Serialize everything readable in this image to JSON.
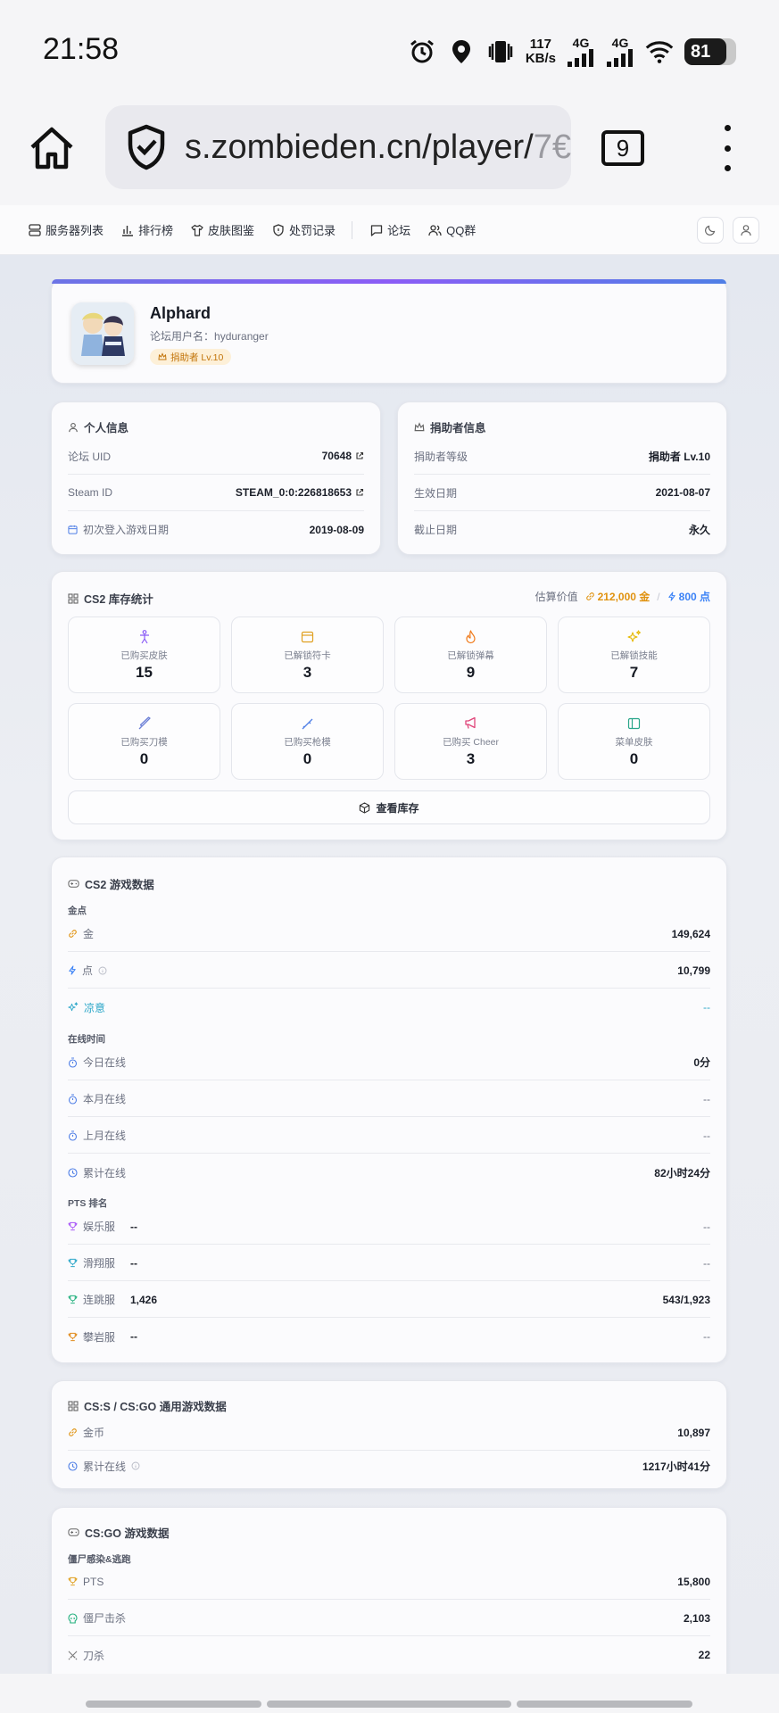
{
  "status": {
    "time": "21:58",
    "speed_value": "117",
    "speed_unit": "KB/s",
    "net1": "4G",
    "net2": "4G",
    "battery": "81"
  },
  "browser": {
    "url_main": "s.zombieden.cn/player/",
    "url_fade": "7€",
    "tab_count": "9"
  },
  "nav": {
    "items": [
      "服务器列表",
      "排行榜",
      "皮肤图鉴",
      "处罚记录",
      "论坛",
      "QQ群"
    ]
  },
  "profile": {
    "name": "Alphard",
    "forum_user_label": "论坛用户名：",
    "forum_user": "hyduranger",
    "badge": "捐助者 Lv.10"
  },
  "personal": {
    "title": "个人信息",
    "rows": [
      {
        "label": "论坛 UID",
        "value": "70648"
      },
      {
        "label": "Steam ID",
        "value": "STEAM_0:0:226818653"
      },
      {
        "label": "初次登入游戏日期",
        "value": "2019-08-09"
      }
    ]
  },
  "donor": {
    "title": "捐助者信息",
    "rows": [
      {
        "label": "捐助者等级",
        "value": "捐助者 Lv.10"
      },
      {
        "label": "生效日期",
        "value": "2021-08-07"
      },
      {
        "label": "截止日期",
        "value": "永久"
      }
    ]
  },
  "inventory": {
    "title": "CS2 库存统计",
    "est_label": "估算价值",
    "gold": "212,000 金",
    "sep": "/",
    "points": "800 点",
    "stats": [
      {
        "label": "已购买皮肤",
        "value": "15",
        "icon": "person-icon",
        "color": "#8b5cf6"
      },
      {
        "label": "已解锁符卡",
        "value": "3",
        "icon": "card-icon",
        "color": "#e0a020"
      },
      {
        "label": "已解锁弹幕",
        "value": "9",
        "icon": "flame-icon",
        "color": "#f07a1a"
      },
      {
        "label": "已解锁技能",
        "value": "7",
        "icon": "sparkle-icon",
        "color": "#e6b800"
      },
      {
        "label": "已购买刀模",
        "value": "0",
        "icon": "knife-icon",
        "color": "#6b7fd6"
      },
      {
        "label": "已购买枪模",
        "value": "0",
        "icon": "gun-icon",
        "color": "#4f7fe6"
      },
      {
        "label": "已购买 Cheer",
        "value": "3",
        "icon": "megaphone-icon",
        "color": "#e0457a"
      },
      {
        "label": "菜单皮肤",
        "value": "0",
        "icon": "panel-icon",
        "color": "#2aa68a"
      }
    ],
    "button": "查看库存"
  },
  "cs2": {
    "title": "CS2 游戏数据",
    "currency_head": "金点",
    "gold_label": "金",
    "gold_value": "149,624",
    "point_label": "点",
    "point_value": "10,799",
    "cool_label": "凉意",
    "cool_value": "--",
    "online_head": "在线时间",
    "online_rows": [
      {
        "label": "今日在线",
        "value": "0分"
      },
      {
        "label": "本月在线",
        "value": "--"
      },
      {
        "label": "上月在线",
        "value": "--"
      },
      {
        "label": "累计在线",
        "value": "82小时24分"
      }
    ],
    "pts_head": "PTS 排名",
    "pts_rows": [
      {
        "label": "娱乐服",
        "mid": "--",
        "value": "--",
        "color": "#a855f7"
      },
      {
        "label": "滑翔服",
        "mid": "--",
        "value": "--",
        "color": "#2aa6c8"
      },
      {
        "label": "连跳服",
        "mid": "1,426",
        "value": "543/1,923",
        "color": "#22b07d"
      },
      {
        "label": "攀岩服",
        "mid": "--",
        "value": "--",
        "color": "#e08a1a"
      }
    ]
  },
  "css": {
    "title": "CS:S / CS:GO 通用游戏数据",
    "rows": [
      {
        "label": "金币",
        "value": "10,897"
      },
      {
        "label": "累计在线",
        "value": "1217小时41分"
      }
    ]
  },
  "csgo": {
    "title": "CS:GO 游戏数据",
    "head": "僵尸感染&逃跑",
    "rows": [
      {
        "label": "PTS",
        "value": "15,800"
      },
      {
        "label": "僵尸击杀",
        "value": "2,103"
      },
      {
        "label": "刀杀",
        "value": "22"
      }
    ]
  }
}
